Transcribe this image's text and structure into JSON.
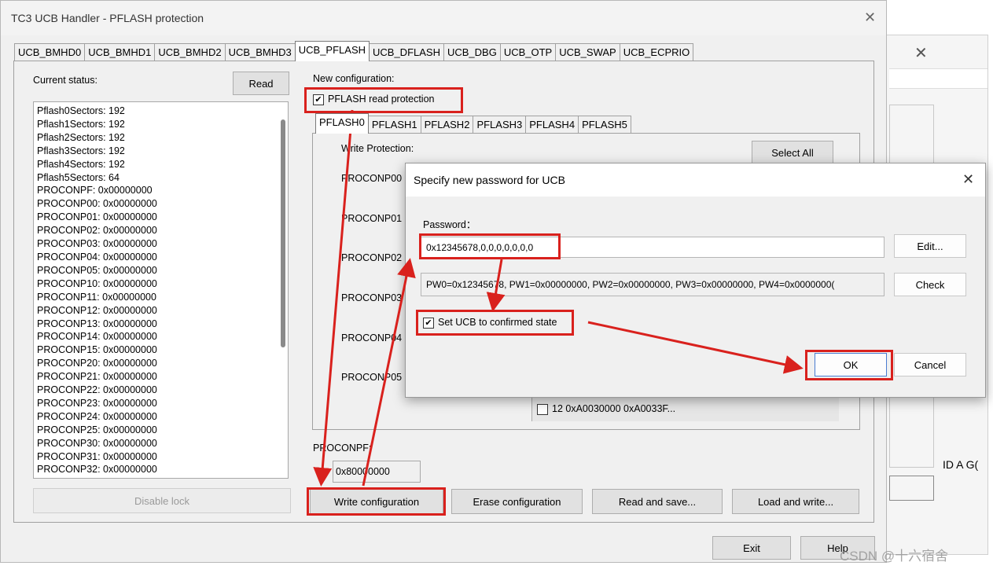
{
  "main_window": {
    "title": "TC3 UCB Handler - PFLASH protection",
    "tabs": [
      "UCB_BMHD0",
      "UCB_BMHD1",
      "UCB_BMHD2",
      "UCB_BMHD3",
      "UCB_PFLASH",
      "UCB_DFLASH",
      "UCB_DBG",
      "UCB_OTP",
      "UCB_SWAP",
      "UCB_ECPRIO"
    ],
    "active_tab": "UCB_PFLASH",
    "current_status_label": "Current status:",
    "read_label": "Read",
    "status_lines": [
      "Pflash0Sectors: 192",
      "Pflash1Sectors: 192",
      "Pflash2Sectors: 192",
      "Pflash3Sectors: 192",
      "Pflash4Sectors: 192",
      "Pflash5Sectors: 64",
      "PROCONPF: 0x00000000",
      "PROCONP00: 0x00000000",
      "PROCONP01: 0x00000000",
      "PROCONP02: 0x00000000",
      "PROCONP03: 0x00000000",
      "PROCONP04: 0x00000000",
      "PROCONP05: 0x00000000",
      "PROCONP10: 0x00000000",
      "PROCONP11: 0x00000000",
      "PROCONP12: 0x00000000",
      "PROCONP13: 0x00000000",
      "PROCONP14: 0x00000000",
      "PROCONP15: 0x00000000",
      "PROCONP20: 0x00000000",
      "PROCONP21: 0x00000000",
      "PROCONP22: 0x00000000",
      "PROCONP23: 0x00000000",
      "PROCONP24: 0x00000000",
      "PROCONP25: 0x00000000",
      "PROCONP30: 0x00000000",
      "PROCONP31: 0x00000000",
      "PROCONP32: 0x00000000"
    ],
    "new_config_label": "New configuration:",
    "pflash_read_protection_label": "PFLASH read protection",
    "pflash_tabs": [
      "PFLASH0",
      "PFLASH1",
      "PFLASH2",
      "PFLASH3",
      "PFLASH4",
      "PFLASH5"
    ],
    "write_protection_label": "Write Protection:",
    "select_all_label": "Select All",
    "proconp_labels": [
      "PROCONP00",
      "PROCONP01",
      "PROCONP02",
      "PROCONP03",
      "PROCONP04",
      "PROCONP05"
    ],
    "sector_row": "12  0xA0030000  0xA0033F...",
    "proconpf_label": "PROCONPF:",
    "proconpf_value": "0x80000000",
    "disable_lock_label": "Disable lock",
    "write_config_label": "Write configuration",
    "erase_config_label": "Erase configuration",
    "read_save_label": "Read and save...",
    "load_write_label": "Load and write...",
    "exit_label": "Exit",
    "help_label": "Help"
  },
  "back_window": {
    "side_text": "ID A G("
  },
  "dialog": {
    "title": "Specify new password for UCB",
    "password_label": "Password：",
    "password_value": "0x12345678,0,0,0,0,0,0,0",
    "password_words": "PW0=0x12345678, PW1=0x00000000, PW2=0x00000000, PW3=0x00000000, PW4=0x0000000(",
    "edit_label": "Edit...",
    "check_label": "Check",
    "confirmed_label": "Set UCB to confirmed state",
    "ok_label": "OK",
    "cancel_label": "Cancel"
  },
  "watermark": "CSDN @十六宿舍",
  "colors": {
    "annotation_red": "#d9211d",
    "window_bg": "#f0f0f0"
  }
}
